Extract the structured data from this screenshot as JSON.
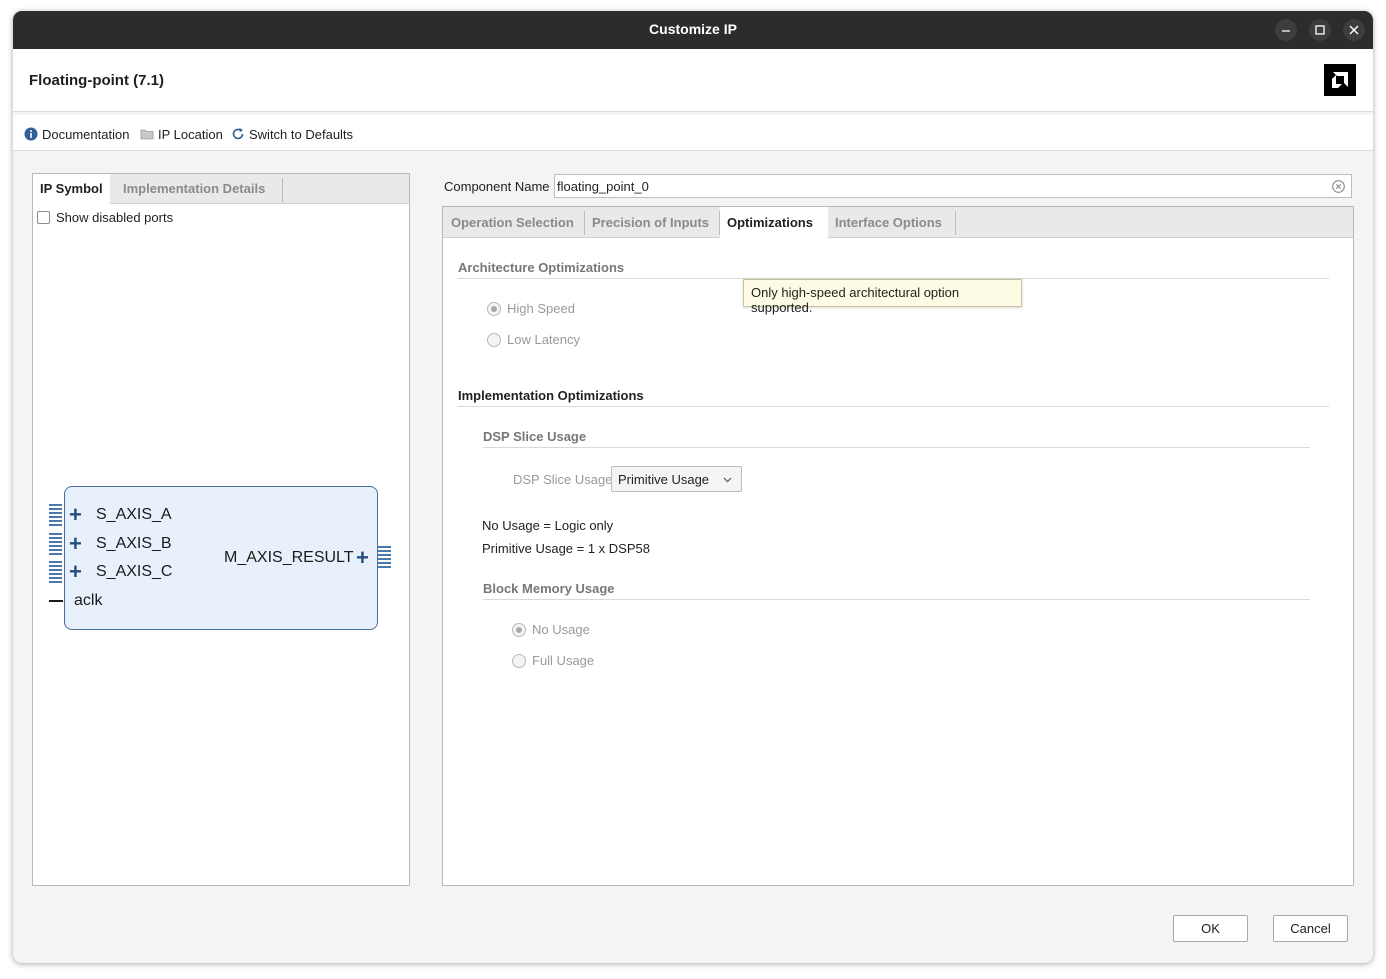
{
  "window": {
    "title": "Customize IP",
    "controls": {
      "minimize": "–",
      "maximize": "□",
      "close": "✕"
    }
  },
  "header": {
    "ip_title": "Floating-point (7.1)"
  },
  "toolbar": {
    "documentation": "Documentation",
    "ip_location": "IP Location",
    "switch_defaults": "Switch to Defaults"
  },
  "left_panel": {
    "tabs": [
      "IP Symbol",
      "Implementation Details"
    ],
    "show_disabled_ports": "Show disabled ports",
    "symbol": {
      "inputs": [
        "S_AXIS_A",
        "S_AXIS_B",
        "S_AXIS_C"
      ],
      "clock": "aclk",
      "output": "M_AXIS_RESULT"
    }
  },
  "component": {
    "label": "Component Name",
    "value": "floating_point_0"
  },
  "right_panel": {
    "tabs": [
      "Operation Selection",
      "Precision of Inputs",
      "Optimizations",
      "Interface Options"
    ],
    "active_tab": "Optimizations",
    "architecture": {
      "title": "Architecture Optimizations",
      "options": [
        "High Speed",
        "Low Latency"
      ],
      "selected": "High Speed",
      "tooltip": "Only high-speed architectural option supported."
    },
    "implementation": {
      "title": "Implementation Optimizations",
      "dsp": {
        "title": "DSP Slice Usage",
        "label": "DSP Slice Usage",
        "value": "Primitive Usage",
        "note1": "No Usage = Logic only",
        "note2": "Primitive Usage = 1 x DSP58"
      },
      "bram": {
        "title": "Block Memory Usage",
        "options": [
          "No Usage",
          "Full Usage"
        ],
        "selected": "No Usage"
      }
    }
  },
  "buttons": {
    "ok": "OK",
    "cancel": "Cancel"
  },
  "colors": {
    "titlebar": "#2c2c2c",
    "symbol_fill": "#e8f1fb",
    "symbol_border": "#4a6d9a",
    "tooltip_bg": "#fdfbe3"
  }
}
